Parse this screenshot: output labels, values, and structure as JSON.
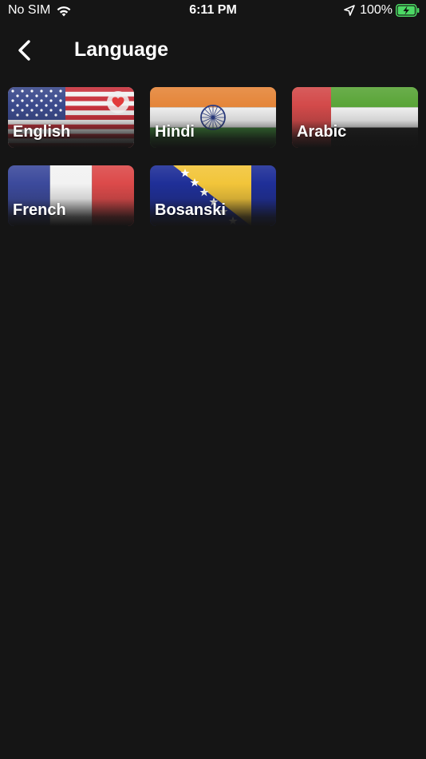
{
  "status_bar": {
    "carrier": "No SIM",
    "time": "6:11 PM",
    "battery_percent": "100%",
    "icons": [
      "wifi-icon",
      "location-arrow-icon",
      "battery-charging-icon"
    ]
  },
  "header": {
    "back_icon": "chevron-left-icon",
    "title": "Language"
  },
  "languages": [
    {
      "label": "English",
      "flag": "usa-flag",
      "favorite": true
    },
    {
      "label": "Hindi",
      "flag": "india-flag",
      "favorite": false
    },
    {
      "label": "Arabic",
      "flag": "uae-flag",
      "favorite": false
    },
    {
      "label": "French",
      "flag": "france-flag",
      "favorite": false
    },
    {
      "label": "Bosanski",
      "flag": "bosnia-flag",
      "favorite": false
    }
  ],
  "colors": {
    "background": "#151515",
    "text": "#ffffff",
    "favorite_heart": "#e23b3b",
    "battery_green": "#4cd964"
  }
}
